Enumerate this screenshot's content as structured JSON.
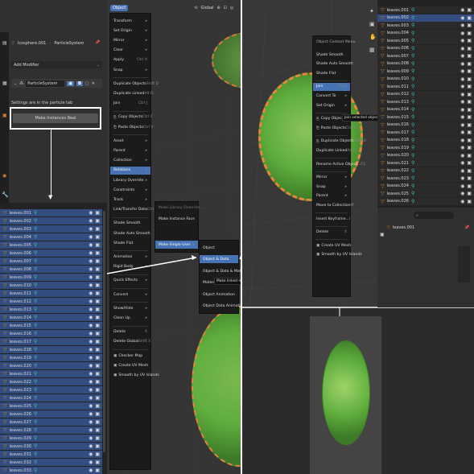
{
  "modifier_panel": {
    "breadcrumb": [
      "Icosphere.001",
      "ParticleSystem"
    ],
    "add_modifier": "Add Modifier",
    "modifier_name": "ParticleSystem",
    "settings_note": "Settings are in the particle tab",
    "make_instances_button": "Make Instances Real"
  },
  "outliner_left": {
    "rows": [
      "leaves.001",
      "leaves.002",
      "leaves.003",
      "leaves.004",
      "leaves.005",
      "leaves.006",
      "leaves.007",
      "leaves.008",
      "leaves.009",
      "leaves.010",
      "leaves.011",
      "leaves.012",
      "leaves.013",
      "leaves.014",
      "leaves.015",
      "leaves.016",
      "leaves.017",
      "leaves.018",
      "leaves.019",
      "leaves.020",
      "leaves.021",
      "leaves.022",
      "leaves.023",
      "leaves.024",
      "leaves.025",
      "leaves.026",
      "leaves.027",
      "leaves.028",
      "leaves.029",
      "leaves.030",
      "leaves.031",
      "leaves.032",
      "leaves.033"
    ]
  },
  "object_menu": {
    "title": "Object",
    "orientation": "Global",
    "items": [
      {
        "label": "Transform",
        "sub": true
      },
      {
        "label": "Set Origin",
        "sub": true
      },
      {
        "label": "Mirror",
        "sub": true
      },
      {
        "label": "Clear",
        "sub": true
      },
      {
        "label": "Apply",
        "shortcut": "Ctrl A"
      },
      {
        "label": "Snap",
        "sub": true
      },
      {
        "sep": true
      },
      {
        "label": "Duplicate Objects",
        "shortcut": "Shift D"
      },
      {
        "label": "Duplicate Linked",
        "shortcut": "Alt D"
      },
      {
        "label": "Join",
        "shortcut": "Ctrl J"
      },
      {
        "sep": true
      },
      {
        "label": "Copy Objects",
        "shortcut": "Ctrl C",
        "icon": "⎘"
      },
      {
        "label": "Paste Objects",
        "shortcut": "Ctrl V",
        "icon": "⎗"
      },
      {
        "sep": true
      },
      {
        "label": "Asset",
        "sub": true
      },
      {
        "label": "Parent",
        "sub": true
      },
      {
        "label": "Collection",
        "sub": true
      },
      {
        "label": "Relations",
        "sub": true,
        "hl": true
      },
      {
        "label": "Library Override",
        "sub": true
      },
      {
        "label": "Constraints",
        "sub": true
      },
      {
        "label": "Track",
        "sub": true
      },
      {
        "label": "Link/Transfer Data",
        "shortcut": "Ctrl L"
      },
      {
        "sep": true
      },
      {
        "label": "Shade Smooth"
      },
      {
        "label": "Shade Auto Smooth"
      },
      {
        "label": "Shade Flat"
      },
      {
        "sep": true
      },
      {
        "label": "Animation",
        "sub": true
      },
      {
        "label": "Rigid Body",
        "sub": true
      },
      {
        "sep": true
      },
      {
        "label": "Quick Effects",
        "sub": true
      },
      {
        "sep": true
      },
      {
        "label": "Convert",
        "sub": true
      },
      {
        "sep": true
      },
      {
        "label": "Show/Hide",
        "sub": true
      },
      {
        "label": "Clean Up",
        "sub": true
      },
      {
        "sep": true
      },
      {
        "label": "Delete",
        "shortcut": "X"
      },
      {
        "label": "Delete Global",
        "shortcut": "Shift X"
      },
      {
        "sep": true
      },
      {
        "label": "Checker Map",
        "icon": "▣"
      },
      {
        "label": "Create UV Mesh",
        "icon": "▣"
      },
      {
        "label": "Smooth by UV Islands",
        "icon": "▣"
      }
    ]
  },
  "relations_menu": {
    "items": [
      "Make Library Override...",
      "Make Instance Face",
      "Make Single User"
    ]
  },
  "single_user_menu": {
    "items": [
      "Object",
      "Object & Data",
      "Object & Data & Materials",
      "Materials",
      "Object Animation",
      "Object Data Animation"
    ],
    "tooltip": "Make linked data local to each object"
  },
  "context_menu": {
    "title": "Object Context Menu",
    "items": [
      {
        "label": "Shade Smooth"
      },
      {
        "label": "Shade Auto Smooth"
      },
      {
        "label": "Shade Flat"
      },
      {
        "sep": true
      },
      {
        "label": "Join",
        "shortcut": "Ctrl J",
        "hl": true
      },
      {
        "label": "Convert To",
        "sub": true
      },
      {
        "label": "Set Origin",
        "sub": true
      },
      {
        "sep": true
      },
      {
        "label": "Copy Objects",
        "shortcut": "Ctrl C",
        "icon": "⎘"
      },
      {
        "label": "Paste Objects",
        "shortcut": "Ctrl V",
        "icon": "⎗"
      },
      {
        "sep": true
      },
      {
        "label": "Duplicate Objects",
        "shortcut": "Shift D",
        "icon": "⎘"
      },
      {
        "label": "Duplicate Linked",
        "shortcut": "Alt D"
      },
      {
        "sep": true
      },
      {
        "label": "Rename Active Object...",
        "shortcut": "F2"
      },
      {
        "sep": true
      },
      {
        "label": "Mirror",
        "sub": true
      },
      {
        "label": "Snap",
        "sub": true
      },
      {
        "label": "Parent",
        "sub": true
      },
      {
        "label": "Move to Collection",
        "shortcut": "M"
      },
      {
        "sep": true
      },
      {
        "label": "Insert Keyframe...",
        "shortcut": "I"
      },
      {
        "sep": true
      },
      {
        "label": "Delete",
        "shortcut": "X"
      },
      {
        "sep": true
      },
      {
        "label": "Create UV Mesh",
        "icon": "▣"
      },
      {
        "label": "Smooth by UV Islands",
        "icon": "▣"
      }
    ],
    "tooltip": "Join selected objects into active object."
  },
  "outliner_right": {
    "rows": [
      "leaves.001",
      "leaves.002",
      "leaves.003",
      "leaves.004",
      "leaves.005",
      "leaves.006",
      "leaves.007",
      "leaves.008",
      "leaves.009",
      "leaves.010",
      "leaves.011",
      "leaves.012",
      "leaves.013",
      "leaves.014",
      "leaves.015",
      "leaves.016",
      "leaves.017",
      "leaves.018",
      "leaves.019",
      "leaves.020",
      "leaves.021",
      "leaves.022",
      "leaves.023",
      "leaves.024",
      "leaves.025",
      "leaves.026"
    ],
    "bottom_item": "leaves.001"
  },
  "colors": {
    "accent": "#4772b3",
    "selected_row": "#334d80",
    "wire": "#e8863a",
    "leaf": "#5fae3d"
  }
}
